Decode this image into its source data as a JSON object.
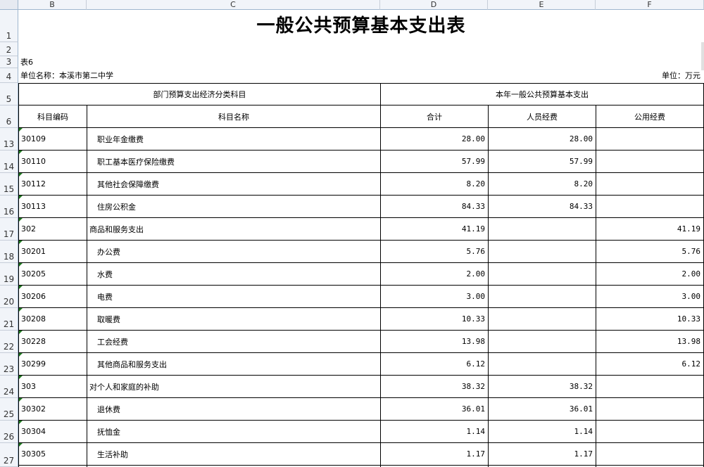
{
  "columns": [
    "B",
    "C",
    "D",
    "E",
    "F"
  ],
  "row_numbers": [
    "1",
    "2",
    "3",
    "4",
    "5",
    "6",
    "13",
    "14",
    "15",
    "16",
    "17",
    "18",
    "19",
    "20",
    "21",
    "22",
    "23",
    "24",
    "25",
    "26",
    "27"
  ],
  "title": "一般公共预算基本支出表",
  "table_no": "表6",
  "unit_name": "单位名称：本溪市第二中学",
  "unit": "单位：万元",
  "header": {
    "group_left": "部门预算支出经济分类科目",
    "group_right": "本年一般公共预算基本支出",
    "code": "科目编码",
    "name": "科目名称",
    "total": "合计",
    "personnel": "人员经费",
    "public": "公用经费"
  },
  "rows": [
    {
      "code": "30109",
      "name": "职业年金缴费",
      "total": "28.00",
      "personnel": "28.00",
      "public": ""
    },
    {
      "code": "30110",
      "name": "职工基本医疗保险缴费",
      "total": "57.99",
      "personnel": "57.99",
      "public": ""
    },
    {
      "code": "30112",
      "name": "其他社会保障缴费",
      "total": "8.20",
      "personnel": "8.20",
      "public": ""
    },
    {
      "code": "30113",
      "name": "住房公积金",
      "total": "84.33",
      "personnel": "84.33",
      "public": ""
    },
    {
      "code": "302",
      "name": "商品和服务支出",
      "total": "41.19",
      "personnel": "",
      "public": "41.19"
    },
    {
      "code": "30201",
      "name": "办公费",
      "total": "5.76",
      "personnel": "",
      "public": "5.76"
    },
    {
      "code": "30205",
      "name": "水费",
      "total": "2.00",
      "personnel": "",
      "public": "2.00"
    },
    {
      "code": "30206",
      "name": "电费",
      "total": "3.00",
      "personnel": "",
      "public": "3.00"
    },
    {
      "code": "30208",
      "name": "取暖费",
      "total": "10.33",
      "personnel": "",
      "public": "10.33"
    },
    {
      "code": "30228",
      "name": "工会经费",
      "total": "13.98",
      "personnel": "",
      "public": "13.98"
    },
    {
      "code": "30299",
      "name": "其他商品和服务支出",
      "total": "6.12",
      "personnel": "",
      "public": "6.12"
    },
    {
      "code": "303",
      "name": "对个人和家庭的补助",
      "total": "38.32",
      "personnel": "38.32",
      "public": ""
    },
    {
      "code": "30302",
      "name": "退休费",
      "total": "36.01",
      "personnel": "36.01",
      "public": ""
    },
    {
      "code": "30304",
      "name": "抚恤金",
      "total": "1.14",
      "personnel": "1.14",
      "public": ""
    },
    {
      "code": "30305",
      "name": "生活补助",
      "total": "1.17",
      "personnel": "1.17",
      "public": ""
    }
  ]
}
